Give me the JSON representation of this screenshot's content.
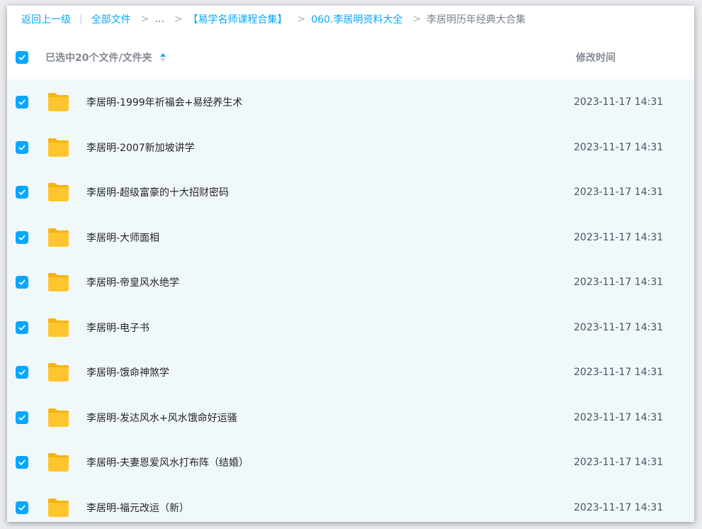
{
  "breadcrumb": {
    "back": "返回上一级",
    "all_files": "全部文件",
    "ellipsis": "...",
    "level1": "【易学名师课程合集】",
    "level2": "060.李居明资料大全",
    "current": "李居明历年经典大合集",
    "separator_bar": "|",
    "separator_arrow": ">"
  },
  "header": {
    "selected_text": "已选中20个文件/文件夹",
    "mtime_label": "修改时间"
  },
  "colors": {
    "accent": "#06a7ff",
    "row_bg": "#f1f8fc",
    "folder": "#ffc52e"
  },
  "rows": [
    {
      "name": "李居明-1999年祈福会+易经养生术",
      "mtime": "2023-11-17 14:31",
      "checked": true
    },
    {
      "name": "李居明-2007新加坡讲学",
      "mtime": "2023-11-17 14:31",
      "checked": true
    },
    {
      "name": "李居明-超级富豪的十大招财密码",
      "mtime": "2023-11-17 14:31",
      "checked": true
    },
    {
      "name": "李居明-大师面相",
      "mtime": "2023-11-17 14:31",
      "checked": true
    },
    {
      "name": "李居明-帝皇风水绝学",
      "mtime": "2023-11-17 14:31",
      "checked": true
    },
    {
      "name": "李居明-电子书",
      "mtime": "2023-11-17 14:31",
      "checked": true
    },
    {
      "name": "李居明-饿命神煞学",
      "mtime": "2023-11-17 14:31",
      "checked": true
    },
    {
      "name": "李居明-发达风水+风水饿命好运骚",
      "mtime": "2023-11-17 14:31",
      "checked": true
    },
    {
      "name": "李居明-夫妻恩爱风水打布阵（结婚）",
      "mtime": "2023-11-17 14:31",
      "checked": true
    },
    {
      "name": "李居明-福元改运（新）",
      "mtime": "2023-11-17 14:31",
      "checked": true
    }
  ]
}
